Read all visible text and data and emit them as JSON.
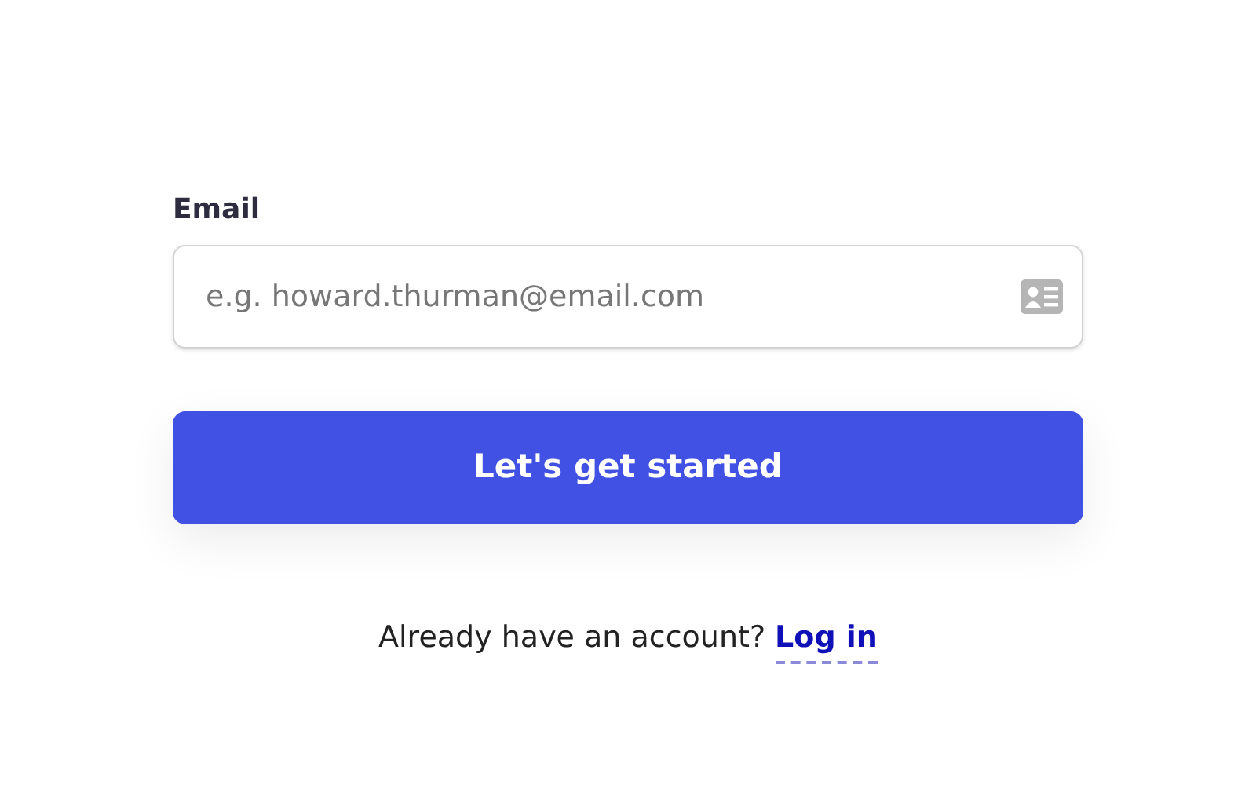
{
  "email": {
    "label": "Email",
    "placeholder": "e.g. howard.thurman@email.com"
  },
  "submit_button": "Let's get started",
  "login_prompt": {
    "text": "Already have an account?",
    "link": "Log in"
  }
}
